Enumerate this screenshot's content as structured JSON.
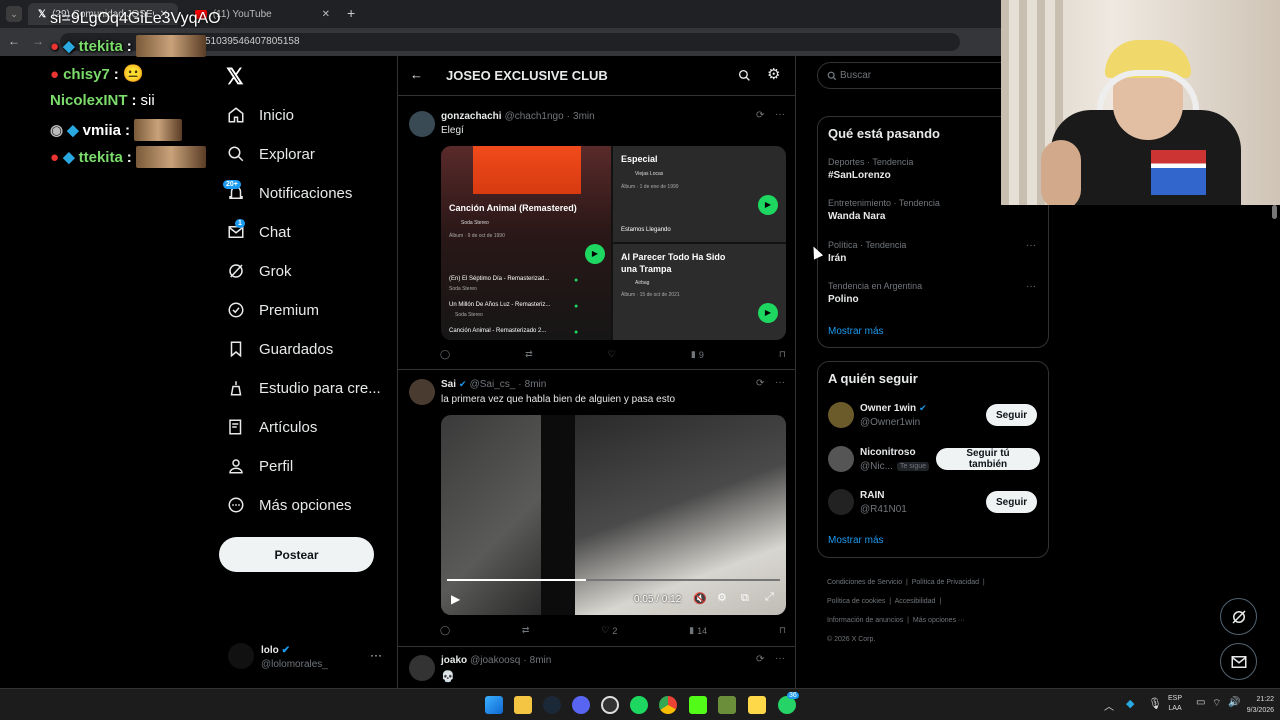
{
  "browser": {
    "tabs": [
      {
        "label": "(29) Comunidad JOSEO EXCLUS..."
      },
      {
        "label": "(11) YouTube"
      }
    ],
    "url": "https://x.com/i/communities/1510395464078051​58",
    "url_display": "51039546407805158",
    "overlay_text_1": "https://youtube/.../a0LJ5w...",
    "overlay_text_2": "si=9LgOq4GiLe3VyqAO"
  },
  "chat": [
    {
      "user": "ttekita",
      "msg": ""
    },
    {
      "user": "chisy7",
      "msg": ""
    },
    {
      "user": "NicolexINT",
      "msg": "sii"
    },
    {
      "user": "vmiia",
      "msg": ""
    },
    {
      "user": "ttekita",
      "msg": ""
    }
  ],
  "nav": {
    "items": [
      {
        "label": "Inicio",
        "icon": "home-icon"
      },
      {
        "label": "Explorar",
        "icon": "search-icon"
      },
      {
        "label": "Notificaciones",
        "icon": "bell-icon",
        "badge": "20+"
      },
      {
        "label": "Chat",
        "icon": "mail-icon",
        "badge": "1"
      },
      {
        "label": "Grok",
        "icon": "grok-icon"
      },
      {
        "label": "Premium",
        "icon": "premium-icon"
      },
      {
        "label": "Guardados",
        "icon": "bookmark-icon"
      },
      {
        "label": "Estudio para cre...",
        "icon": "studio-icon"
      },
      {
        "label": "Artículos",
        "icon": "articles-icon"
      },
      {
        "label": "Perfil",
        "icon": "person-icon"
      },
      {
        "label": "Más opciones",
        "icon": "more-icon"
      }
    ],
    "post_button": "Postear",
    "account": {
      "name": "lolo",
      "handle": "@lolomorales_"
    }
  },
  "community": {
    "title": "JOSEO EXCLUSIVE CLUB"
  },
  "tweets": [
    {
      "name": "gonzachachi",
      "handle": "@chach1ngo",
      "time": "3min",
      "text": "Elegí",
      "spotify": {
        "left": {
          "title": "Canción Animal (Remastered)",
          "artist": "Soda Stereo",
          "meta": "Álbum · 9 de oct de 1990",
          "tracks": [
            {
              "t": "(En) El Séptimo Día - Remasterizad...",
              "a": "Soda Stereo"
            },
            {
              "t": "Un Millón De Años Luz - Remasteriz...",
              "a": "Soda Stereo"
            },
            {
              "t": "Canción Animal - Remasterizado 2...",
              "a": ""
            }
          ]
        },
        "right_top": {
          "title": "Especial",
          "artist": "Viejas Locas",
          "meta": "Álbum · 1 de ene de 1999",
          "track": "Estamos Llegando",
          "track_artist": "Viejas Locas"
        },
        "right_bottom": {
          "title": "Al Parecer Todo Ha Sido una Trampa",
          "artist": "Airbag",
          "meta": "Álbum · 15 de oct de 2021"
        }
      },
      "views": "9"
    },
    {
      "name": "Sai",
      "handle": "@Sai_cs_",
      "time": "8min",
      "text": "la primera vez que habla bien de alguien y pasa esto",
      "video_time": "0:05 / 0:12",
      "likes": "2",
      "views": "14"
    },
    {
      "name": "joako",
      "handle": "@joakoosq",
      "time": "8min",
      "text": "💀"
    }
  ],
  "sidebar": {
    "search_placeholder": "Buscar",
    "trends_title": "Qué está pasando",
    "trends": [
      {
        "cat": "Deportes · Tendencia",
        "name": "#SanLorenzo"
      },
      {
        "cat": "Entretenimiento · Tendencia",
        "name": "Wanda Nara"
      },
      {
        "cat": "Política · Tendencia",
        "name": "Irán"
      },
      {
        "cat": "Tendencia en Argentina",
        "name": "Polino"
      }
    ],
    "show_more": "Mostrar más",
    "follow_title": "A quién seguir",
    "follow": [
      {
        "name": "Owner 1win",
        "handle": "@Owner1win",
        "button": "Seguir",
        "follows_you": ""
      },
      {
        "name": "Niconitroso",
        "handle": "@Nic...",
        "button": "Seguir tú también",
        "follows_you": "Te sigue"
      },
      {
        "name": "RAIN",
        "handle": "@R41N01",
        "button": "Seguir",
        "follows_you": ""
      }
    ],
    "follow_more": "Mostrar más",
    "footer": [
      "Condiciones de Servicio",
      "Política de Privacidad",
      "Política de cookies",
      "Accesibilidad",
      "Información de anuncios",
      "Más opciones ···",
      "© 2026 X Corp."
    ]
  },
  "taskbar": {
    "lang": "ESP",
    "lang2": "LAA",
    "time": "21:22",
    "date": "9/3/2026",
    "whatsapp_badge": "36"
  },
  "colors": {
    "accent": "#1d9bf0",
    "spotify_green": "#1ed760",
    "background": "#000000"
  }
}
